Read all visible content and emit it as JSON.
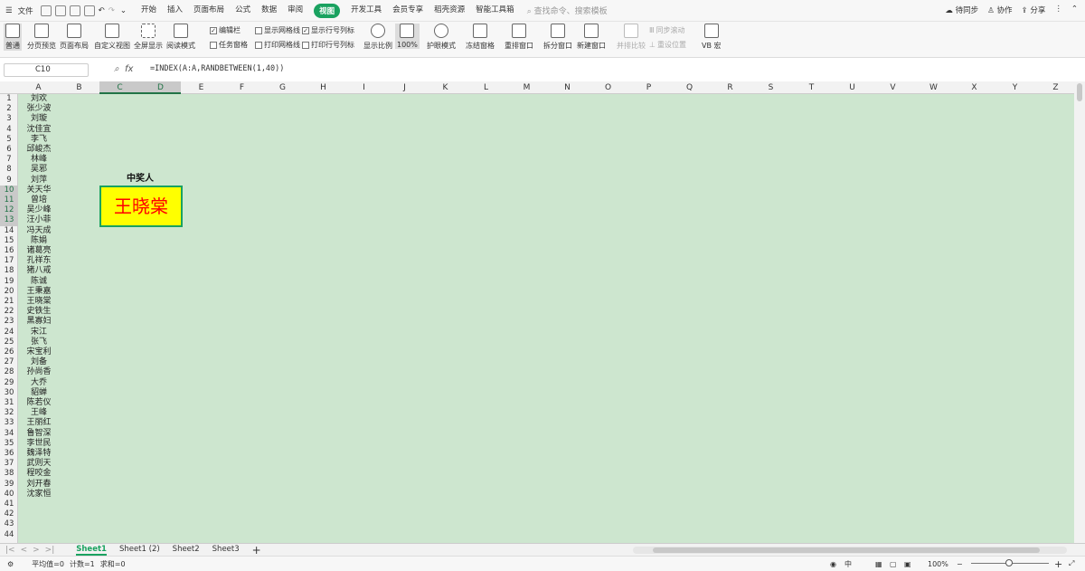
{
  "menubar": {
    "file": "文件",
    "tabs": [
      "开始",
      "插入",
      "页面布局",
      "公式",
      "数据",
      "审阅",
      "视图",
      "开发工具",
      "会员专享",
      "稻壳资源",
      "智能工具箱"
    ],
    "active_tab": "视图",
    "search_placeholder": "查找命令、搜索模板",
    "sync": "待同步",
    "collab": "协作",
    "share": "分享"
  },
  "ribbon": {
    "normal": "普通",
    "page_preview": "分页预览",
    "page_layout": "页面布局",
    "custom_view": "自定义视图",
    "fullscreen": "全屏显示",
    "reading_mode": "阅读模式",
    "edit_bar": "编辑栏",
    "show_gridlines": "显示网格线",
    "show_rowcol": "显示行号列标",
    "task_pane": "任务窗格",
    "print_gridlines": "打印网格线",
    "print_rowcol": "打印行号列标",
    "zoom": "显示比例",
    "zoom100": "100%",
    "eye_mode": "护眼模式",
    "freeze": "冻结窗格",
    "arrange": "重排窗口",
    "split": "拆分窗口",
    "new_window": "新建窗口",
    "side_by_side": "并排比较",
    "sync_scroll": "同步滚动",
    "reset_pos": "重设位置",
    "vb_macro": "VB 宏"
  },
  "formula_bar": {
    "cell_ref": "C10",
    "fx": "fx",
    "formula": "=INDEX(A:A,RANDBETWEEN(1,40))"
  },
  "columns": [
    "A",
    "B",
    "C",
    "D",
    "E",
    "F",
    "G",
    "H",
    "I",
    "J",
    "K",
    "L",
    "M",
    "N",
    "O",
    "P",
    "Q",
    "R",
    "S",
    "T",
    "U",
    "V",
    "W",
    "X",
    "Y",
    "Z"
  ],
  "rows": [
    "1",
    "2",
    "3",
    "4",
    "5",
    "6",
    "7",
    "8",
    "9",
    "10",
    "11",
    "12",
    "13",
    "14",
    "15",
    "16",
    "17",
    "18",
    "19",
    "20",
    "21",
    "22",
    "23",
    "24",
    "25",
    "26",
    "27",
    "28",
    "29",
    "30",
    "31",
    "32",
    "33",
    "34",
    "35",
    "36",
    "37",
    "38",
    "39",
    "40",
    "41",
    "42",
    "43",
    "44"
  ],
  "names": [
    "刘欢",
    "张少波",
    "刘璇",
    "沈佳宜",
    "李飞",
    "邱峻杰",
    "林峰",
    "吴邪",
    "刘萍",
    "关天华",
    "曾培",
    "吴少峰",
    "汪小菲",
    "冯天成",
    "陈娟",
    "诸葛亮",
    "孔祥东",
    "猪八戒",
    "陈诚",
    "王秉嘉",
    "王晓棠",
    "史铁生",
    "黑寡妇",
    "宋江",
    "张飞",
    "宋宝利",
    "刘备",
    "孙尚香",
    "大乔",
    "貂蝉",
    "陈若仪",
    "王峰",
    "王丽红",
    "鲁智深",
    "李世民",
    "魏泽特",
    "武则天",
    "程咬金",
    "刘开春",
    "沈家恒"
  ],
  "winner": {
    "label": "中奖人",
    "name": "王晓棠"
  },
  "sheets": [
    "Sheet1",
    "Sheet1 (2)",
    "Sheet2",
    "Sheet3"
  ],
  "active_sheet": "Sheet1",
  "statusbar": {
    "avg": "平均值=0",
    "count": "计数=1",
    "sum": "求和=0",
    "zoom": "100%"
  },
  "colors": {
    "accent": "#1aa260",
    "eye_green": "#cde6cf",
    "winner_bg": "#ffff00",
    "winner_text": "#ff0000"
  }
}
